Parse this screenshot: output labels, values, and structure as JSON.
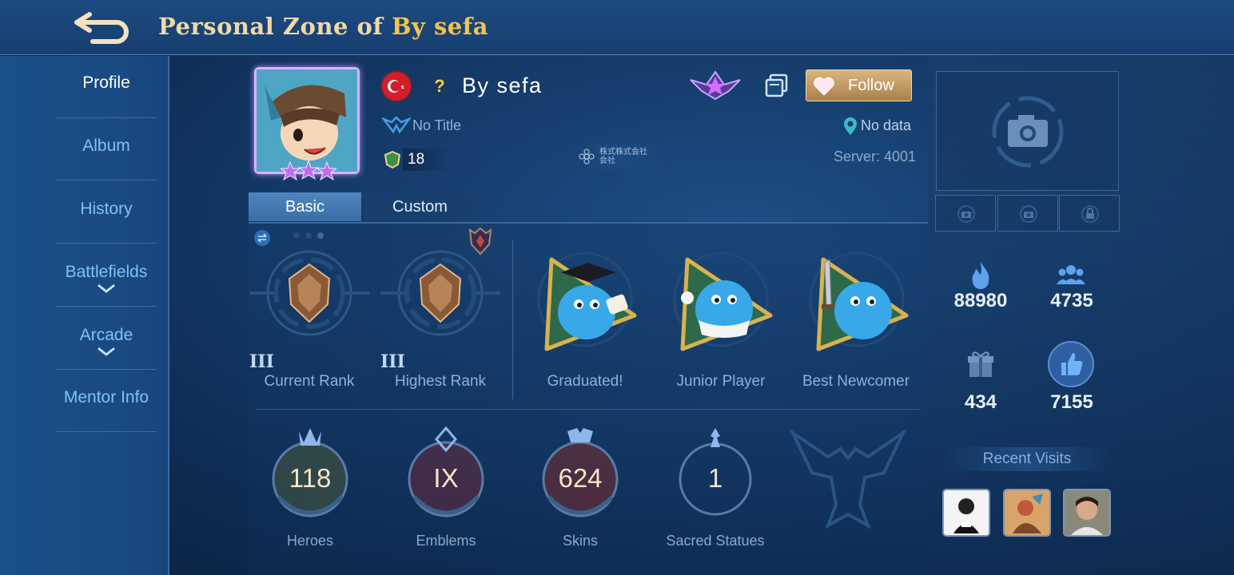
{
  "header": {
    "title_prefix": "Personal Zone of",
    "title_name": "By sefa",
    "back_icon": "back-arrow-icon"
  },
  "sidebar": {
    "items": [
      {
        "label": "Profile",
        "active": true
      },
      {
        "label": "Album"
      },
      {
        "label": "History"
      },
      {
        "label": "Battlefields",
        "has_dropdown": true
      },
      {
        "label": "Arcade",
        "has_dropdown": true
      },
      {
        "label": "Mentor Info"
      }
    ]
  },
  "profile": {
    "question_mark": "?",
    "name": "By sefa",
    "title": "No Title",
    "level": "18",
    "squad_text": "株式株式会社会社",
    "follow_label": "Follow",
    "location": "No data",
    "server": "Server: 4001",
    "flag": "turkey-flag-icon"
  },
  "tabs": [
    {
      "label": "Basic",
      "active": true
    },
    {
      "label": "Custom"
    }
  ],
  "ranks": [
    {
      "roman": "III",
      "label": "Current Rank"
    },
    {
      "roman": "III",
      "label": "Highest Rank"
    }
  ],
  "achievements": [
    {
      "label": "Graduated!"
    },
    {
      "label": "Junior Player"
    },
    {
      "label": "Best Newcomer"
    }
  ],
  "stats": [
    {
      "value": "118",
      "label": "Heroes"
    },
    {
      "value": "IX",
      "label": "Emblems"
    },
    {
      "value": "624",
      "label": "Skins"
    },
    {
      "value": "1",
      "label": "Sacred Statues"
    }
  ],
  "right": {
    "popularity": "88980",
    "followers": "4735",
    "gifts": "434",
    "likes": "7155",
    "recent_title": "Recent Visits"
  },
  "colors": {
    "accent_gold": "#f3c44e",
    "title_cream": "#efd9a6",
    "link_blue": "#7fc2f2",
    "follow_gold": "#d9b680"
  }
}
